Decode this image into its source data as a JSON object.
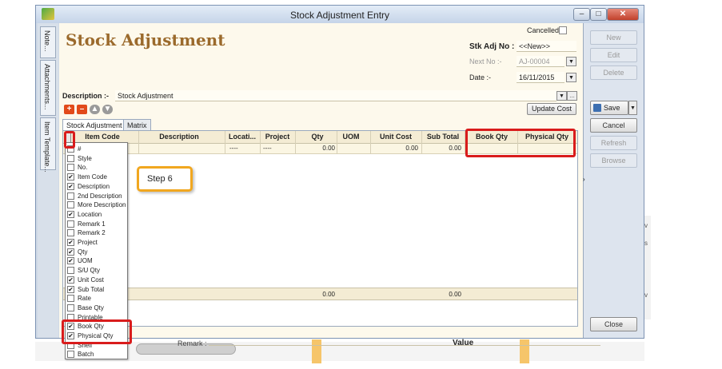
{
  "window": {
    "title": "Stock Adjustment Entry"
  },
  "left_tabs": [
    "Note...",
    "Attachments...",
    "Item Template..."
  ],
  "form": {
    "heading": "Stock Adjustment",
    "cancelled_label": "Cancelled",
    "stk_adj_no_label": "Stk Adj No :",
    "stk_adj_no_value": "<<New>>",
    "next_no_label": "Next No :-",
    "next_no_value": "AJ-00004",
    "date_label": "Date :-",
    "date_value": "16/11/2015",
    "description_label": "Description :-",
    "description_value": "Stock Adjustment"
  },
  "toolbar": {
    "update_cost_label": "Update Cost"
  },
  "tabs": [
    {
      "label": "Stock Adjustment"
    },
    {
      "label": "Matrix"
    }
  ],
  "grid": {
    "columns": [
      "Item Code",
      "Description",
      "Locati...",
      "Project",
      "Qty",
      "UOM",
      "Unit Cost",
      "Sub Total",
      "Book Qty",
      "Physical Qty"
    ],
    "row": {
      "location": "----",
      "project": "----",
      "qty": "0.00",
      "unit_cost": "0.00",
      "sub_total": "0.00"
    },
    "totals": {
      "qty": "0.00",
      "sub_total": "0.00"
    }
  },
  "column_chooser": [
    {
      "label": "#",
      "checked": false
    },
    {
      "label": "Style",
      "checked": false
    },
    {
      "label": "No.",
      "checked": false
    },
    {
      "label": "Item Code",
      "checked": true
    },
    {
      "label": "Description",
      "checked": true
    },
    {
      "label": "2nd Description",
      "checked": false
    },
    {
      "label": "More Description",
      "checked": false
    },
    {
      "label": "Location",
      "checked": true
    },
    {
      "label": "Remark 1",
      "checked": false
    },
    {
      "label": "Remark 2",
      "checked": false
    },
    {
      "label": "Project",
      "checked": true
    },
    {
      "label": "Qty",
      "checked": true
    },
    {
      "label": "UOM",
      "checked": true
    },
    {
      "label": "S/U Qty",
      "checked": false
    },
    {
      "label": "Unit Cost",
      "checked": true
    },
    {
      "label": "Sub Total",
      "checked": true
    },
    {
      "label": "Rate",
      "checked": false
    },
    {
      "label": "Base Qty",
      "checked": false
    },
    {
      "label": "Printable",
      "checked": false
    },
    {
      "label": "Book Qty",
      "checked": true
    },
    {
      "label": "Physical Qty",
      "checked": true
    },
    {
      "label": "Shelf",
      "checked": false
    },
    {
      "label": "Batch",
      "checked": false
    }
  ],
  "remark_label": "Remark :",
  "actions": {
    "new": "New",
    "edit": "Edit",
    "delete": "Delete",
    "save": "Save",
    "cancel": "Cancel",
    "refresh": "Refresh",
    "browse": "Browse",
    "close": "Close"
  },
  "annotation": {
    "step_label": "Step 6",
    "highlight_color": "#d91c1c",
    "callout_color": "#f1a71f"
  },
  "background": {
    "value_label": "Value",
    "edge_labels": [
      "v",
      "s",
      "v"
    ]
  },
  "icons": [
    "add-icon",
    "remove-icon",
    "move-up-icon",
    "move-down-icon",
    "save-disk-icon",
    "dropdown-arrow-icon",
    "app-icon"
  ]
}
